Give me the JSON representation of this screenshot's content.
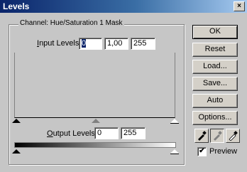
{
  "window": {
    "title": "Levels",
    "close_glyph": "×"
  },
  "channel_caption": "Channel:  Hue/Saturation 1 Mask",
  "input_levels": {
    "label_prefix": "I",
    "label_rest": "nput Levels:",
    "black": "0",
    "gamma": "1,00",
    "white": "255"
  },
  "output_levels": {
    "label_prefix": "O",
    "label_rest": "utput Levels:",
    "black": "0",
    "white": "255"
  },
  "buttons": {
    "ok": "OK",
    "reset": "Reset",
    "load": "Load...",
    "save": "Save...",
    "auto": "Auto",
    "options": "Options..."
  },
  "preview": {
    "label": "Preview",
    "checked": true,
    "check_glyph": "✔"
  },
  "icons": [
    "close-icon",
    "black-eyedropper-icon",
    "gray-eyedropper-icon",
    "white-eyedropper-icon"
  ]
}
